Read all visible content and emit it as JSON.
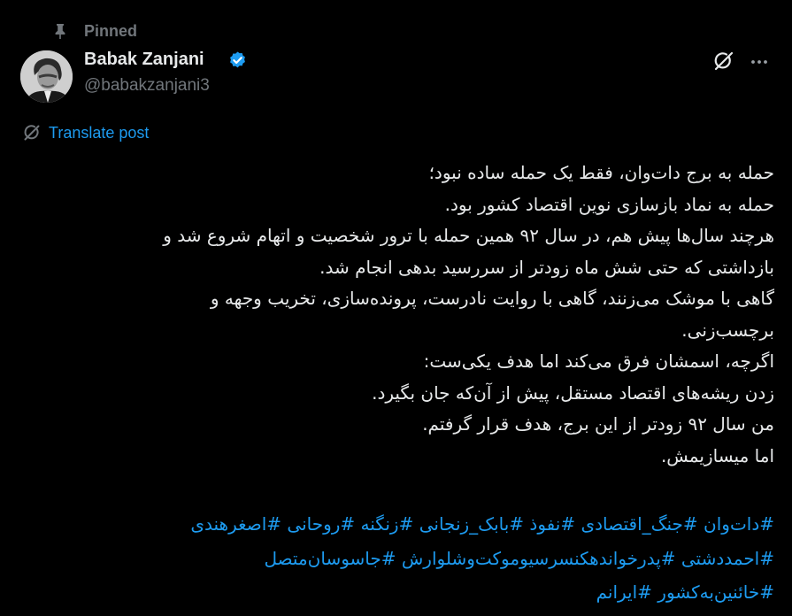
{
  "pinned": {
    "label": "Pinned",
    "icon": "pin-icon"
  },
  "author": {
    "name": "Babak Zanjani",
    "handle": "@babakzanjani3",
    "verified_icon": "verified-badge-icon",
    "verified_color": "#1d9bf0"
  },
  "actions": {
    "grok_icon": "grok-icon",
    "more_icon": "more-options-icon"
  },
  "translate": {
    "label": "Translate post",
    "icon": "translate-icon"
  },
  "post": {
    "lines": [
      "حمله به برج دات‌وان، فقط یک حمله ساده نبود؛",
      "حمله به نماد بازسازی نوین اقتصاد کشور بود.",
      "هرچند سال‌ها پیش هم، در سال ۹۲ همین حمله  با ترور شخصیت و اتهام شروع شد و",
      "بازداشتی که حتی شش ماه زودتر از سررسید بدهی انجام شد.",
      "گاهی با موشک می‌زنند، گاهی با روایت نادرست، پرونده‌سازی، تخریب وجهه و",
      "برچسب‌زنی.",
      "اگرچه، اسمشان فرق می‌کند اما هدف یکی‌ست:",
      "زدن ریشه‌های اقتصاد مستقل، پیش از آن‌که جان بگیرد.",
      "من سال ۹۲ زودتر از این برج، هدف قرار گرفتم.",
      "اما میسازیمش."
    ],
    "hashtags": [
      [
        "#دات‌وان",
        "#جنگ_اقتصادی",
        "#نفوذ",
        "#بابک_زنجانی",
        "#زنگنه",
        "#روحانی",
        "#اصغرهندی"
      ],
      [
        "#احمددشتی",
        "#پدرخواندهکنسرسیوموکت‌وشلوارش",
        "#جاسوسان‌متصل"
      ],
      [
        "#خائنین‌به‌کشور",
        "#ایرانم"
      ]
    ]
  },
  "colors": {
    "background": "#000000",
    "text": "#e7e9ea",
    "muted": "#71767b",
    "link": "#1d9bf0"
  }
}
